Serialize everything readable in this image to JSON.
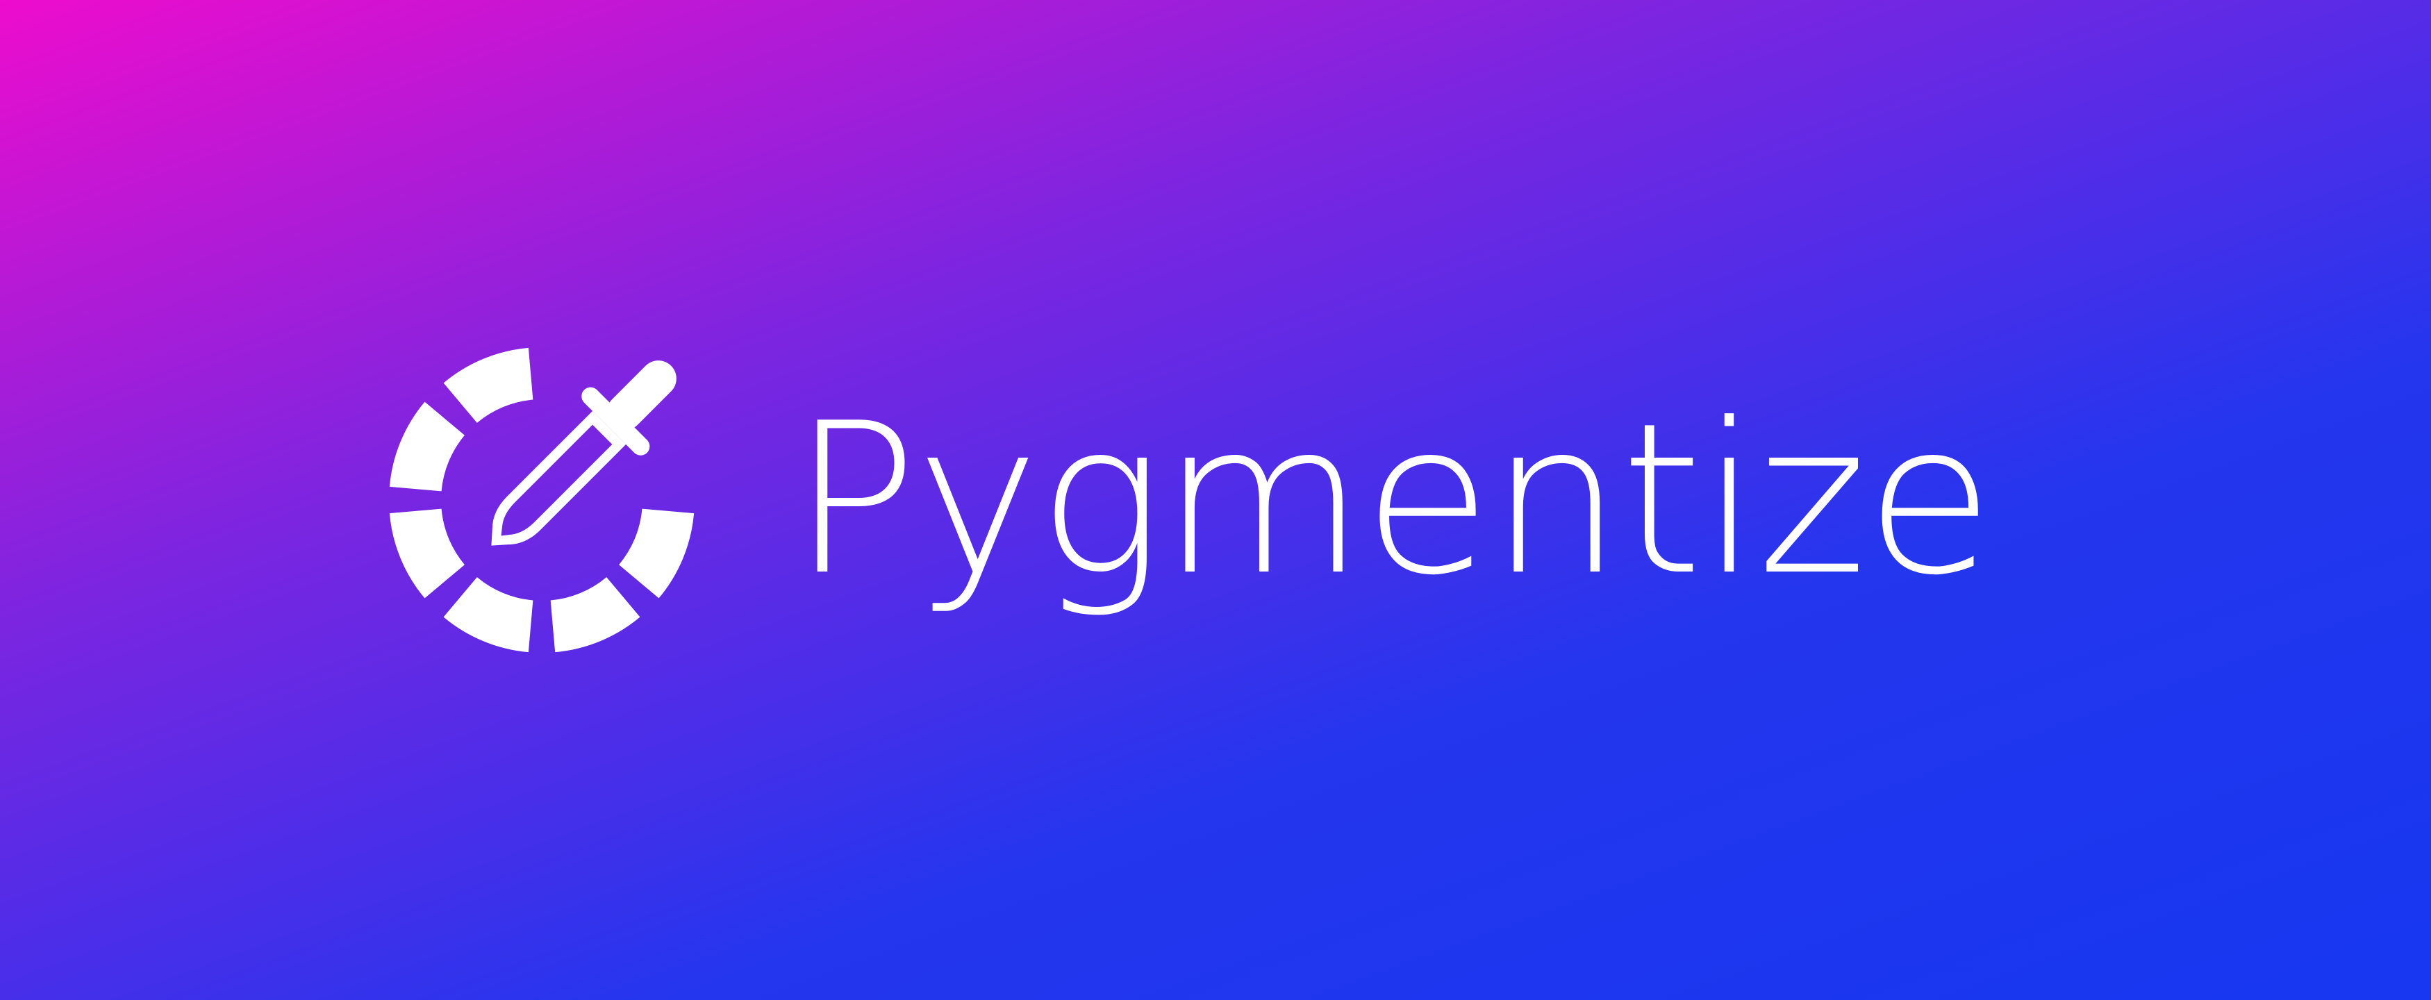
{
  "brand": {
    "name": "Pygmentize",
    "logo_icon": "eyedropper-target-icon"
  },
  "colors": {
    "gradient_start": "#ee0ccd",
    "gradient_end": "#1737f0",
    "foreground": "#ffffff"
  }
}
